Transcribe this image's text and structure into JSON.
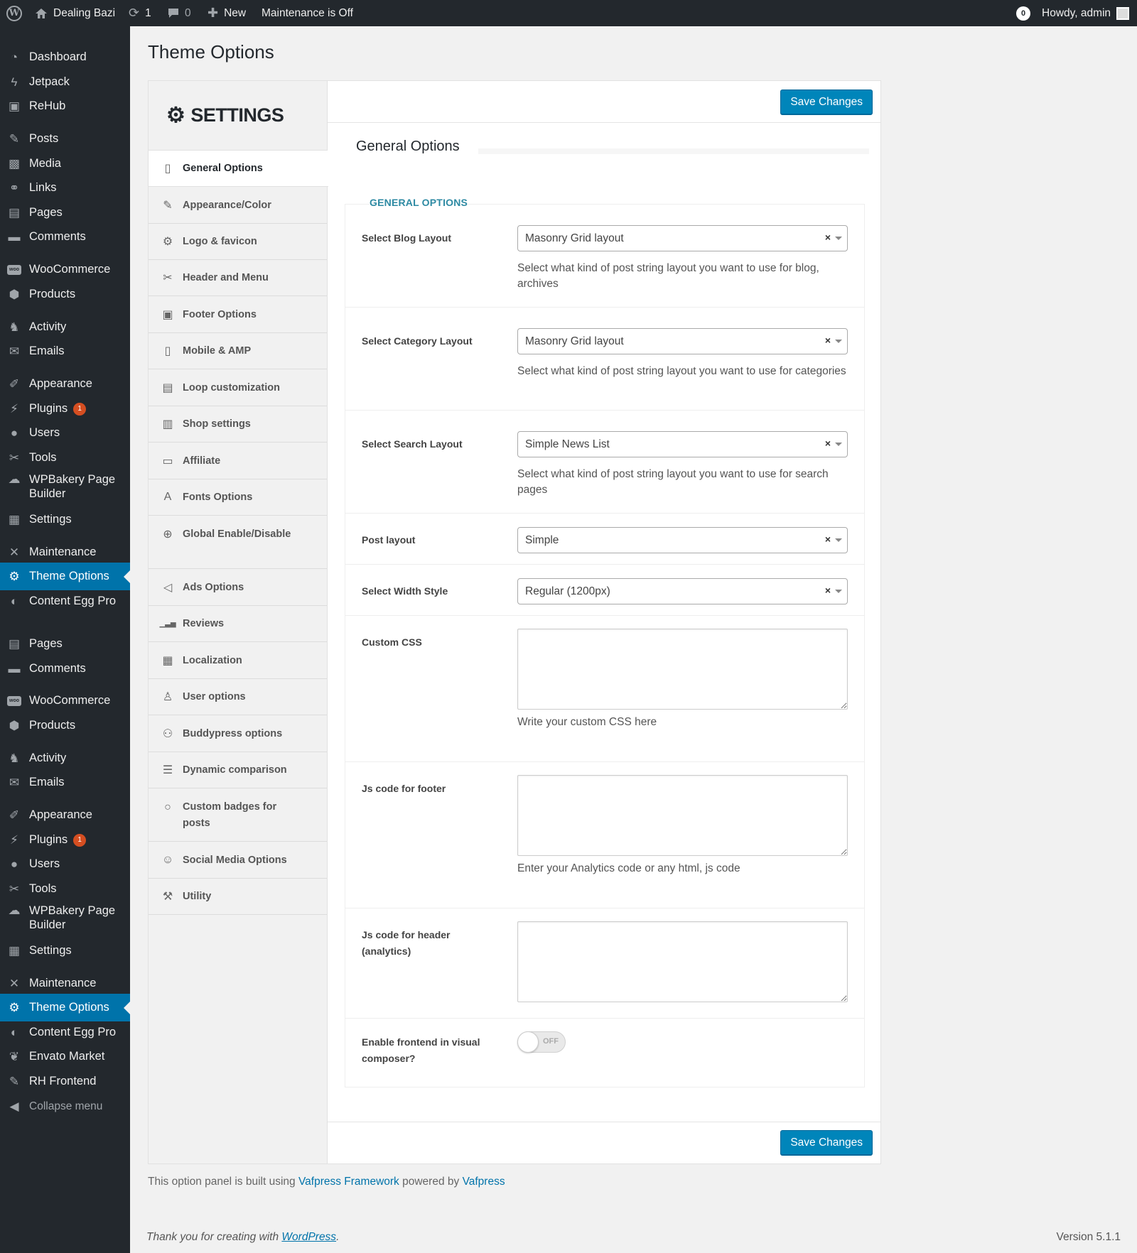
{
  "adminbar": {
    "site_name": "Dealing Bazi",
    "updates_count": "1",
    "comments_count": "0",
    "new_label": "New",
    "maintenance_label": "Maintenance is Off",
    "notif_count": "0",
    "howdy": "Howdy, admin"
  },
  "admin_menu": {
    "items": [
      {
        "label": "Dashboard",
        "icon": "dashboard-icon"
      },
      {
        "label": "Jetpack",
        "icon": "jetpack-icon"
      },
      {
        "label": "ReHub",
        "icon": "monitor-icon"
      },
      {
        "label": "Posts",
        "icon": "pin-icon"
      },
      {
        "label": "Media",
        "icon": "media-icon"
      },
      {
        "label": "Links",
        "icon": "link-icon"
      },
      {
        "label": "Pages",
        "icon": "pages-icon"
      },
      {
        "label": "Comments",
        "icon": "comment-icon"
      },
      {
        "label": "WooCommerce",
        "icon": "woo-icon"
      },
      {
        "label": "Products",
        "icon": "box-icon"
      },
      {
        "label": "Activity",
        "icon": "activity-icon"
      },
      {
        "label": "Emails",
        "icon": "email-icon"
      },
      {
        "label": "Appearance",
        "icon": "brush-icon"
      },
      {
        "label": "Plugins",
        "icon": "plugin-icon",
        "badge": "1"
      },
      {
        "label": "Users",
        "icon": "user-icon"
      },
      {
        "label": "Tools",
        "icon": "wrench-icon"
      },
      {
        "label": "WPBakery Page Builder",
        "icon": "cloud-icon"
      },
      {
        "label": "Settings",
        "icon": "settings-icon"
      },
      {
        "label": "Maintenance",
        "icon": "tools-cross-icon"
      },
      {
        "label": "Theme Options",
        "icon": "gear-icon"
      },
      {
        "label": "Content Egg Pro",
        "icon": "egg-icon"
      },
      {
        "label": "Pages",
        "icon": "pages-icon"
      },
      {
        "label": "Comments",
        "icon": "comment-icon"
      },
      {
        "label": "WooCommerce",
        "icon": "woo-icon"
      },
      {
        "label": "Products",
        "icon": "box-icon"
      },
      {
        "label": "Activity",
        "icon": "activity-icon"
      },
      {
        "label": "Emails",
        "icon": "email-icon"
      },
      {
        "label": "Appearance",
        "icon": "brush-icon"
      },
      {
        "label": "Plugins",
        "icon": "plugin-icon",
        "badge": "1"
      },
      {
        "label": "Users",
        "icon": "user-icon"
      },
      {
        "label": "Tools",
        "icon": "wrench-icon"
      },
      {
        "label": "WPBakery Page Builder",
        "icon": "cloud-icon"
      },
      {
        "label": "Settings",
        "icon": "settings-icon"
      },
      {
        "label": "Maintenance",
        "icon": "tools-cross-icon"
      },
      {
        "label": "Theme Options",
        "icon": "gear-icon"
      },
      {
        "label": "Content Egg Pro",
        "icon": "egg-icon"
      },
      {
        "label": "Envato Market",
        "icon": "leaf-icon"
      },
      {
        "label": "RH Frontend",
        "icon": "pin-icon"
      },
      {
        "label": "Collapse menu",
        "icon": "collapse-icon"
      }
    ]
  },
  "page": {
    "title": "Theme Options",
    "settings_heading": "SETTINGS",
    "save_label": "Save Changes",
    "section_title": "General Options",
    "group_label": "GENERAL OPTIONS"
  },
  "side_nav": [
    {
      "label": "General Options",
      "icon": "phone-outline-icon"
    },
    {
      "label": "Appearance/Color",
      "icon": "edit-icon"
    },
    {
      "label": "Logo & favicon",
      "icon": "cog-small-icon"
    },
    {
      "label": "Header and Menu",
      "icon": "wrench-icon"
    },
    {
      "label": "Footer Options",
      "icon": "footer-box-icon"
    },
    {
      "label": "Mobile & AMP",
      "icon": "mobile-icon"
    },
    {
      "label": "Loop customization",
      "icon": "document-icon"
    },
    {
      "label": "Shop settings",
      "icon": "barcode-icon"
    },
    {
      "label": "Affiliate",
      "icon": "money-icon"
    },
    {
      "label": "Fonts Options",
      "icon": "font-icon"
    },
    {
      "label": "Global Enable/Disable",
      "icon": "globe-icon"
    },
    {
      "label": "Ads Options",
      "icon": "megaphone-icon"
    },
    {
      "label": "Reviews",
      "icon": "bars-icon"
    },
    {
      "label": "Localization",
      "icon": "translate-icon"
    },
    {
      "label": "User options",
      "icon": "person-icon"
    },
    {
      "label": "Buddypress options",
      "icon": "group-icon"
    },
    {
      "label": "Dynamic comparison",
      "icon": "database-icon"
    },
    {
      "label": "Custom badges for posts",
      "icon": "badge-icon"
    },
    {
      "label": "Social Media Options",
      "icon": "social-icon"
    },
    {
      "label": "Utility",
      "icon": "utility-icon"
    }
  ],
  "options": {
    "blog_layout": {
      "label": "Select Blog Layout",
      "value": "Masonry Grid layout",
      "desc": "Select what kind of post string layout you want to use for blog, archives"
    },
    "category_layout": {
      "label": "Select Category Layout",
      "value": "Masonry Grid layout",
      "desc": "Select what kind of post string layout you want to use for categories"
    },
    "search_layout": {
      "label": "Select Search Layout",
      "value": "Simple News List",
      "desc": "Select what kind of post string layout you want to use for search pages"
    },
    "post_layout": {
      "label": "Post layout",
      "value": "Simple"
    },
    "width_style": {
      "label": "Select Width Style",
      "value": "Regular (1200px)"
    },
    "custom_css": {
      "label": "Custom CSS",
      "desc": "Write your custom CSS here"
    },
    "js_footer": {
      "label": "Js code for footer",
      "desc": "Enter your Analytics code or any html, js code"
    },
    "js_header": {
      "label": "Js code for header (analytics)"
    },
    "frontend_vc": {
      "label": "Enable frontend in visual composer?",
      "toggle": "OFF"
    }
  },
  "footer": {
    "credit_prefix": "This option panel is built using ",
    "credit_link1": "Vafpress Framework",
    "credit_mid": " powered by ",
    "credit_link2": "Vafpress",
    "thanks_prefix": "Thank you for creating with ",
    "thanks_link": "WordPress",
    "thanks_suffix": ".",
    "version": "Version 5.1.1"
  }
}
